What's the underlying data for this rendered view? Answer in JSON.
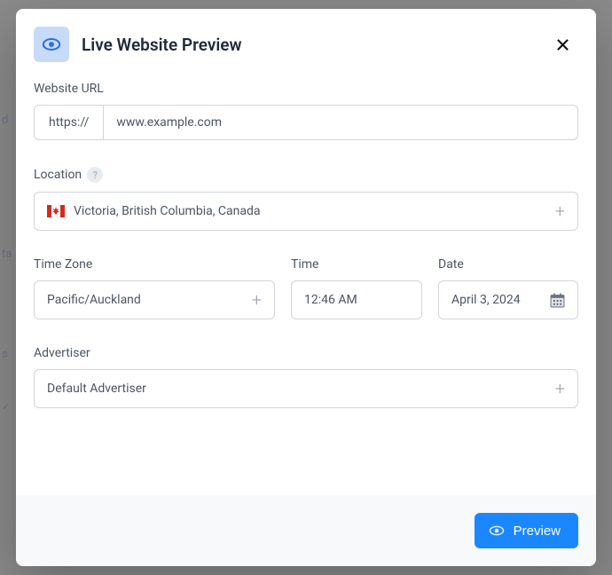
{
  "header": {
    "title": "Live Website Preview"
  },
  "url": {
    "label": "Website URL",
    "prefix": "https://",
    "value": "www.example.com"
  },
  "location": {
    "label": "Location",
    "value": "Victoria, British Columbia, Canada",
    "flag": "canada"
  },
  "timezone": {
    "label": "Time Zone",
    "value": "Pacific/Auckland"
  },
  "time": {
    "label": "Time",
    "value": "12:46 AM"
  },
  "date": {
    "label": "Date",
    "value": "April 3, 2024"
  },
  "advertiser": {
    "label": "Advertiser",
    "value": "Default Advertiser"
  },
  "footer": {
    "preview_label": "Preview"
  }
}
